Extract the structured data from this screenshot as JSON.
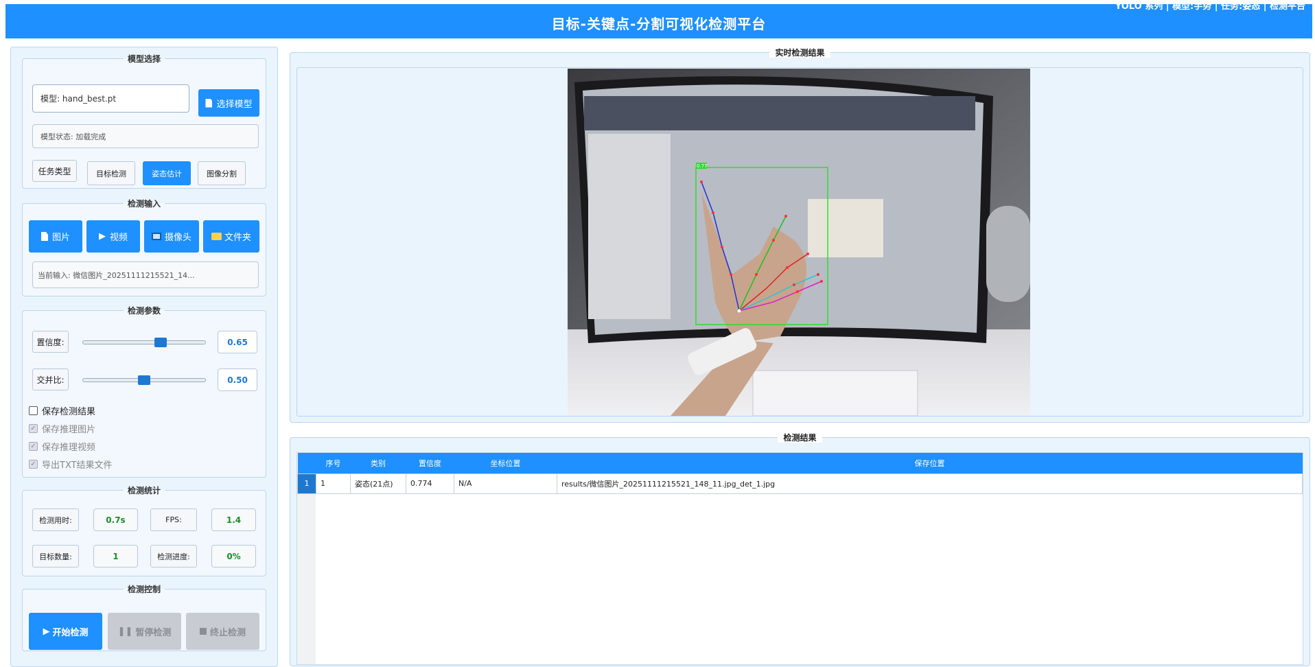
{
  "window": {
    "title": "目标-关键点-分割可视化检测平台",
    "top_right_text": "YOLO 系列  |  模型:手势  |  任务:姿态  |  检测平台"
  },
  "model_select": {
    "legend": "模型选择",
    "model_label": "模型: hand_best.pt",
    "select_button": "选择模型",
    "status": "模型状态: 加载完成",
    "task_type_label": "任务类型",
    "task_detect": "目标检测",
    "task_pose": "姿态估计",
    "task_segment": "图像分割"
  },
  "detect_input": {
    "legend": "检测输入",
    "btn_image": "图片",
    "btn_video": "视频",
    "btn_camera": "摄像头",
    "btn_folder": "文件夹",
    "current_input": "当前输入: 微信图片_20251111215521_14..."
  },
  "detect_params": {
    "legend": "检测参数",
    "confidence_label": "置信度:",
    "confidence_value": "0.65",
    "confidence_fraction": 0.65,
    "iou_label": "交并比:",
    "iou_value": "0.50",
    "iou_fraction": 0.5,
    "save_results": "保存检测结果",
    "save_images": "保存推理图片",
    "save_video": "保存推理视频",
    "export_txt": "导出TXT结果文件"
  },
  "detect_stats": {
    "legend": "检测统计",
    "time_label": "检测用时:",
    "time_value": "0.7s",
    "fps_label": "FPS:",
    "fps_value": "1.4",
    "count_label": "目标数量:",
    "count_value": "1",
    "progress_label": "检测进度:",
    "progress_value": "0%"
  },
  "detect_control": {
    "legend": "检测控制",
    "start": "开始检测",
    "pause": "暂停检测",
    "stop": "终止检测"
  },
  "realtime": {
    "legend": "实时检测结果",
    "box_label": "0.77"
  },
  "results": {
    "legend": "检测结果",
    "columns": [
      "序号",
      "类别",
      "置信度",
      "坐标位置",
      "保存位置"
    ],
    "rows": [
      {
        "index": "1",
        "seq": "1",
        "cls": "姿态(21点)",
        "conf": "0.774",
        "pos": "N/A",
        "path": "results/微信图片_20251111215521_148_11.jpg_det_1.jpg"
      }
    ]
  },
  "colors": {
    "accent": "#1e90ff",
    "panel_bg": "#eaf4fd",
    "value_blue": "#1e78d0",
    "value_green": "#1c8c2c"
  }
}
